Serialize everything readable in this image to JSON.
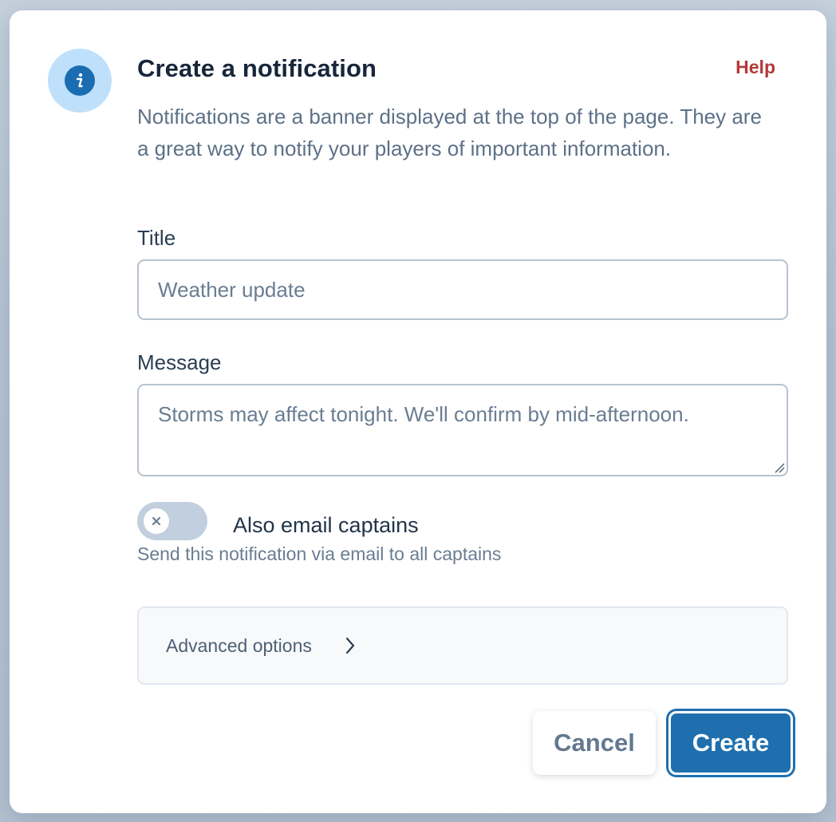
{
  "dialog": {
    "title": "Create a notification",
    "help_label": "Help",
    "description": "Notifications are a banner displayed at the top of the page. They are a great way to notify your players of important information.",
    "info_icon": "info-icon"
  },
  "form": {
    "title_label": "Title",
    "title_value": "Weather update",
    "message_label": "Message",
    "message_value": "Storms may affect tonight. We'll confirm by mid-afternoon.",
    "email_toggle": {
      "label": "Also email captains",
      "help": "Send this notification via email to all captains",
      "enabled": false
    },
    "advanced_label": "Advanced options"
  },
  "actions": {
    "cancel_label": "Cancel",
    "create_label": "Create"
  },
  "colors": {
    "accent": "#1f6fae",
    "help_link": "#b4383a",
    "info_badge": "#bfe0fb"
  }
}
